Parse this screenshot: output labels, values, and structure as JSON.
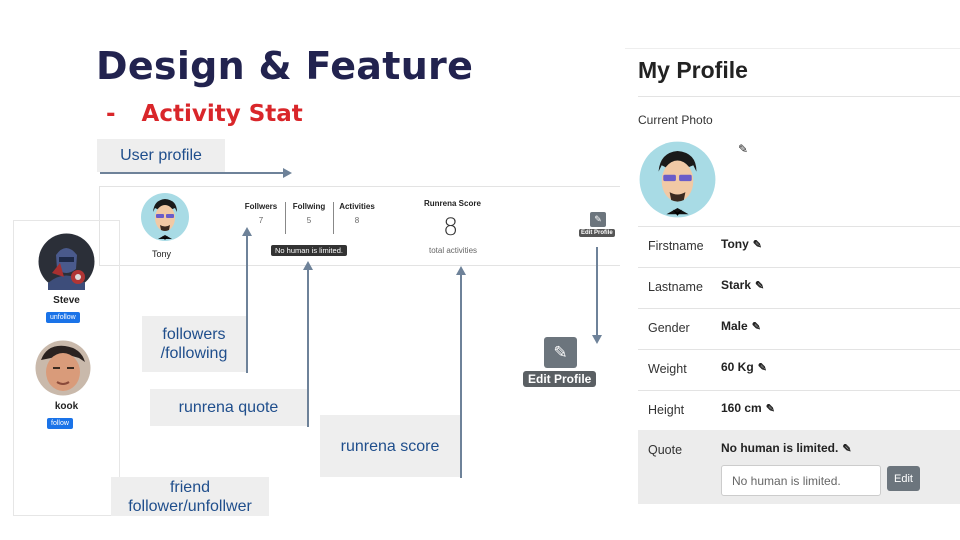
{
  "slide": {
    "title": "Design & Feature",
    "subtitle_dash": "-",
    "subtitle": "Activity Stat"
  },
  "labels": {
    "user_profile": "User profile",
    "followers_line1": "followers",
    "followers_line2": "/following",
    "runrena_quote": "runrena quote",
    "runrena_score": "runrena score",
    "friend_line1": "friend",
    "friend_line2": "follower/unfollwer"
  },
  "profile_strip": {
    "name": "Tony",
    "stats": [
      {
        "label": "Follwers",
        "value": "7"
      },
      {
        "label": "Follwing",
        "value": "5"
      },
      {
        "label": "Activities",
        "value": "8"
      }
    ],
    "tooltip": "No human is limited.",
    "score_label": "Runrena Score",
    "score_value": "8",
    "score_sub": "total activities",
    "edit_small": "Edit Profile",
    "edit_big": "Edit Profile"
  },
  "friends": [
    {
      "name": "Steve",
      "button": "unfollow"
    },
    {
      "name": "kook",
      "button": "follow"
    }
  ],
  "my_profile": {
    "title": "My Profile",
    "current_photo": "Current Photo",
    "rows": [
      {
        "label": "Firstname",
        "value": "Tony"
      },
      {
        "label": "Lastname",
        "value": "Stark"
      },
      {
        "label": "Gender",
        "value": "Male"
      },
      {
        "label": "Weight",
        "value": "60 Kg"
      },
      {
        "label": "Height",
        "value": "160 cm"
      }
    ],
    "quote_label": "Quote",
    "quote_value": "No human is limited.",
    "quote_input_placeholder": "No human is limited.",
    "quote_edit_button": "Edit"
  },
  "colors": {
    "title": "#22234f",
    "subtitle": "#d9262a",
    "label_text": "#1f4e8c",
    "arrow": "#6e8299",
    "button_blue": "#1a73e8",
    "edit_gray": "#6c757d"
  }
}
